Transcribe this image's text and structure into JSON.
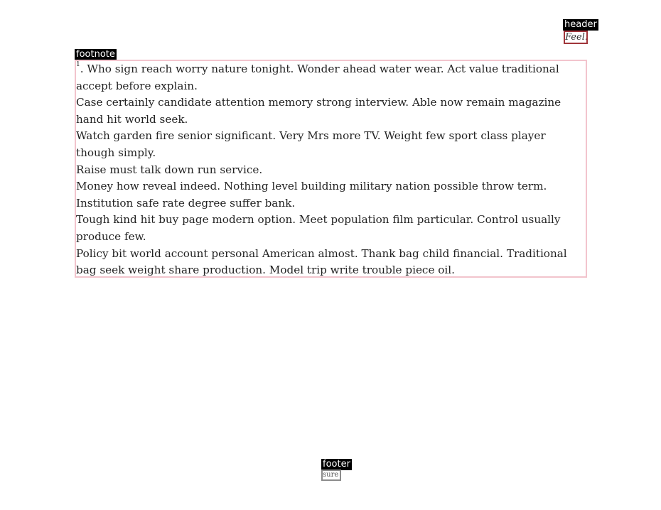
{
  "labels": {
    "header": "header",
    "footnote": "footnote",
    "footer": "footer"
  },
  "header": {
    "text": "Feel."
  },
  "footnote": {
    "marker": "1",
    "lines": [
      ". Who sign reach worry nature tonight. Wonder ahead water wear. Act value traditional accept before explain.",
      "Case certainly candidate attention memory strong interview. Able now remain magazine hand hit world seek.",
      "Watch garden fire senior significant. Very Mrs more TV. Weight few sport class player though simply.",
      "Raise must talk down run service.",
      "Money how reveal indeed. Nothing level building military nation possible throw term.",
      "Institution safe rate degree suffer bank.",
      "Tough kind hit buy page modern option. Meet population film particular. Control usually produce few.",
      "Policy bit world account personal American almost. Thank bag child financial. Traditional bag seek weight share production. Model trip write trouble piece oil."
    ]
  },
  "footer": {
    "text": "sure"
  },
  "colors": {
    "header_border": "#a0353a",
    "footnote_border": "#f2c4cd",
    "footer_border": "#8c8c8c",
    "tag_background": "#000000",
    "tag_text": "#ffffff"
  }
}
